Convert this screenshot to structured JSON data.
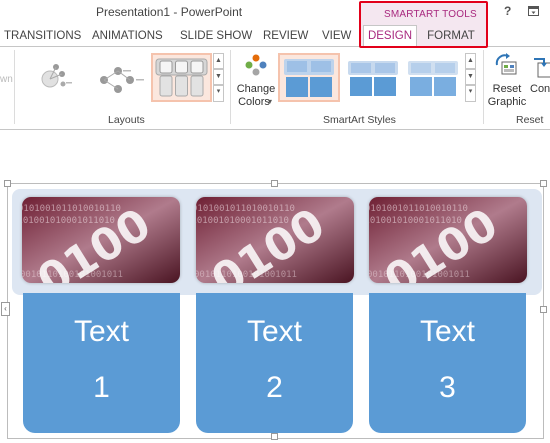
{
  "window": {
    "title": "Presentation1 - PowerPoint",
    "help": "?"
  },
  "contextual": {
    "group": "SMARTART TOOLS",
    "tabs": [
      "DESIGN",
      "FORMAT"
    ]
  },
  "tabs": [
    "TRANSITIONS",
    "ANIMATIONS",
    "SLIDE SHOW",
    "REVIEW",
    "VIEW"
  ],
  "ribbon": {
    "partial_left": "wn",
    "layouts": {
      "label": "Layouts"
    },
    "change_colors": {
      "line1": "Change",
      "line2": "Colors",
      "arrow": "▾"
    },
    "smartart_styles": {
      "label": "SmartArt Styles"
    },
    "reset_graphic": {
      "line1": "Reset",
      "line2": "Graphic"
    },
    "convert": {
      "partial": "Con"
    },
    "reset": {
      "label": "Reset"
    }
  },
  "colors": {
    "accent": "#a8297f",
    "highlight": "#e2001a",
    "card": "#5b9bd5",
    "band": "#dde6f2"
  },
  "smartart": {
    "items": [
      {
        "line1": "Text",
        "line2": "1",
        "image": "binary-digits-photo"
      },
      {
        "line1": "Text",
        "line2": "2",
        "image": "binary-digits-photo"
      },
      {
        "line1": "Text",
        "line2": "3",
        "image": "binary-digits-photo"
      }
    ]
  }
}
